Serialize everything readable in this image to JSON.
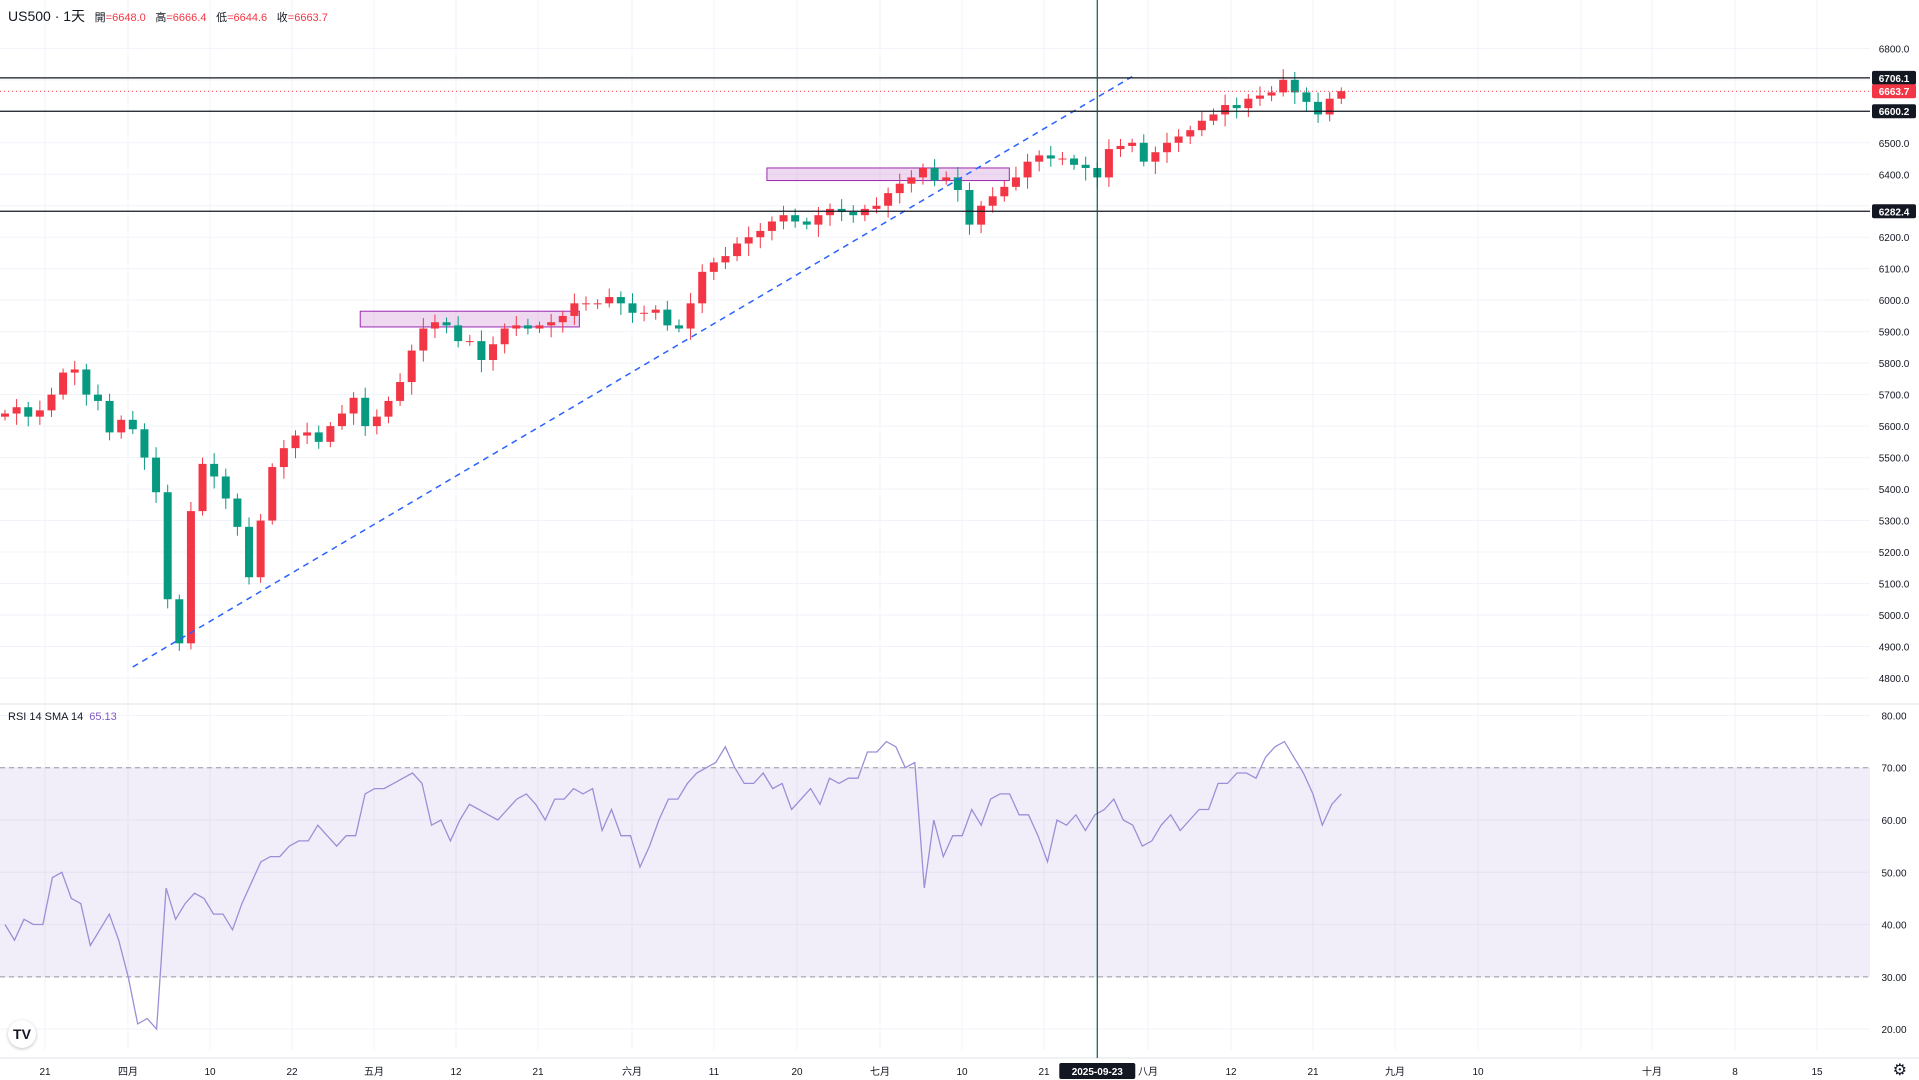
{
  "header": {
    "symbol": "US500 · 1天",
    "open_label": "開",
    "open": "=6648.0",
    "high_label": "高",
    "high": "=6666.4",
    "low_label": "低",
    "low": "=6644.6",
    "close_label": "收",
    "close": "=6663.7"
  },
  "rsi_header": {
    "label": "RSI 14 SMA 14",
    "value": "65.13"
  },
  "logo_text": "TV",
  "colors": {
    "up": "#f23645",
    "down": "#089981",
    "grid": "#f0f3fa",
    "hline": "#131722",
    "crosshair": "#0a5c4a",
    "trend": "#2962ff",
    "rsi": "#9b8fd8",
    "box": "#ce93d8"
  },
  "chart_data": [
    {
      "type": "candlestick",
      "title": "US500 · 1天",
      "ylim": [
        4730,
        6890
      ],
      "price_ticks": [
        "6800.0",
        "6700.0",
        "6500.0",
        "6400.0",
        "6300.0",
        "6200.0",
        "6100.0",
        "6000.0",
        "5900.0",
        "5800.0",
        "5700.0",
        "5600.0",
        "5500.0",
        "5400.0",
        "5300.0",
        "5200.0",
        "5100.0",
        "5000.0",
        "4900.0",
        "4800.0"
      ],
      "x_labels": [
        "21",
        "四月",
        "10",
        "22",
        "五月",
        "12",
        "21",
        "六月",
        "11",
        "20",
        "七月",
        "10",
        "21",
        "八月",
        "12",
        "21",
        "九月",
        "10",
        "2025-09-23",
        "十月",
        "8",
        "15"
      ],
      "horizontal_lines": [
        {
          "value": 6706.1,
          "label": "6706.1"
        },
        {
          "value": 6600.2,
          "label": "6600.2"
        },
        {
          "value": 6282.4,
          "label": "6282.4"
        }
      ],
      "current_price": {
        "value": 6663.7,
        "label": "6663.7"
      },
      "trendline": {
        "from": {
          "bar": 11,
          "value": 4835
        },
        "to": {
          "bar": 97,
          "value": 6710
        }
      },
      "zones": [
        {
          "from_bar": 31,
          "to_bar": 49,
          "high": 5965,
          "low": 5915
        },
        {
          "from_bar": 66,
          "to_bar": 86,
          "high": 6420,
          "low": 6380
        }
      ],
      "crosshair_bar": 94,
      "crosshair_label": "2025-09-23",
      "closes": [
        5640,
        5660,
        5630,
        5650,
        5700,
        5770,
        5780,
        5700,
        5680,
        5580,
        5620,
        5590,
        5500,
        5390,
        5050,
        4910,
        5330,
        5480,
        5440,
        5370,
        5280,
        5120,
        5300,
        5470,
        5530,
        5570,
        5580,
        5550,
        5600,
        5640,
        5690,
        5600,
        5630,
        5680,
        5740,
        5840,
        5910,
        5930,
        5920,
        5870,
        5870,
        5810,
        5860,
        5910,
        5920,
        5910,
        5920,
        5930,
        5950,
        5990,
        5990,
        5990,
        6010,
        5990,
        5960,
        5960,
        5970,
        5920,
        5910,
        5990,
        6090,
        6120,
        6140,
        6180,
        6200,
        6220,
        6250,
        6270,
        6250,
        6240,
        6270,
        6290,
        6280,
        6270,
        6290,
        6300,
        6340,
        6370,
        6390,
        6420,
        6380,
        6390,
        6350,
        6240,
        6300,
        6330,
        6360,
        6390,
        6440,
        6460,
        6450,
        6450,
        6430,
        6420,
        6390,
        6480,
        6490,
        6500,
        6440,
        6470,
        6500,
        6520,
        6540,
        6570,
        6590,
        6620,
        6610,
        6640,
        6650,
        6660,
        6700,
        6660,
        6630,
        6590,
        6640,
        6664
      ]
    },
    {
      "type": "line",
      "title": "RSI 14 SMA 14",
      "ylim": [
        16,
        82
      ],
      "y_ticks": [
        "80.00",
        "70.00",
        "60.00",
        "50.00",
        "40.00",
        "30.00",
        "20.00"
      ],
      "band": [
        30,
        70
      ],
      "values": [
        40,
        37,
        41,
        40,
        40,
        49,
        50,
        45,
        44,
        36,
        39,
        42,
        37,
        30,
        21,
        22,
        20,
        47,
        41,
        44,
        46,
        45,
        42,
        42,
        39,
        44,
        48,
        52,
        53,
        53,
        55,
        56,
        56,
        59,
        57,
        55,
        57,
        57,
        65,
        66,
        66,
        67,
        68,
        69,
        67,
        59,
        60,
        56,
        60,
        63,
        62,
        61,
        60,
        62,
        64,
        65,
        63,
        60,
        64,
        64,
        66,
        65,
        66,
        58,
        62,
        57,
        57,
        51,
        55,
        60,
        64,
        64,
        67,
        69,
        70,
        71,
        74,
        70,
        67,
        67,
        69,
        66,
        67,
        62,
        64,
        66,
        63,
        68,
        67,
        68,
        68,
        73,
        73,
        75,
        74,
        70,
        71,
        47,
        60,
        53,
        57,
        57,
        62,
        59,
        64,
        65,
        65,
        61,
        61,
        57,
        52,
        60,
        59,
        61,
        58,
        61,
        62,
        64,
        60,
        59,
        55,
        56,
        59,
        61,
        58,
        60,
        62,
        62,
        67,
        67,
        69,
        69,
        68,
        72,
        74,
        75,
        72,
        69,
        65,
        59,
        63,
        65
      ]
    }
  ]
}
